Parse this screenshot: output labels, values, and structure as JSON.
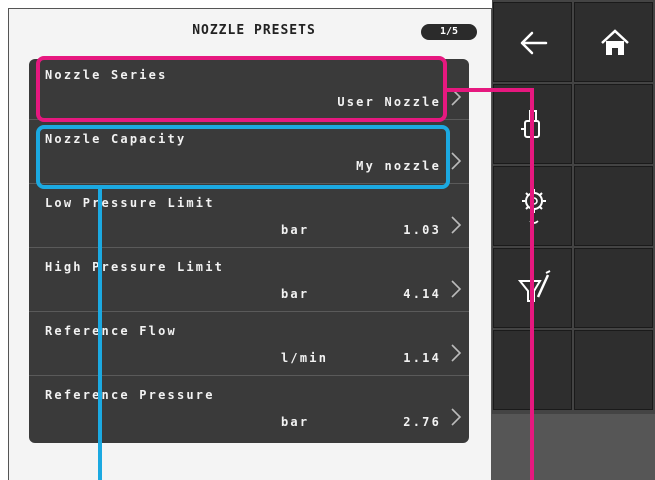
{
  "header": {
    "title": "NOZZLE PRESETS",
    "page_indicator": "1/5"
  },
  "rows": [
    {
      "label": "Nozzle Series",
      "unit": "",
      "value": "User Nozzle"
    },
    {
      "label": "Nozzle Capacity",
      "unit": "",
      "value": "My nozzle"
    },
    {
      "label": "Low Pressure Limit",
      "unit": "bar",
      "value": "1.03"
    },
    {
      "label": "High Pressure Limit",
      "unit": "bar",
      "value": "4.14"
    },
    {
      "label": "Reference Flow",
      "unit": "l/min",
      "value": "1.14"
    },
    {
      "label": "Reference Pressure",
      "unit": "bar",
      "value": "2.76"
    }
  ],
  "sidebar": {
    "buttons": [
      {
        "name": "back-button",
        "icon": "arrow-left-icon"
      },
      {
        "name": "home-button",
        "icon": "home-icon"
      },
      {
        "name": "nozzle-select-button",
        "icon": "nozzle-hand-icon"
      },
      {
        "name": "sidebar-blank-button-1",
        "icon": ""
      },
      {
        "name": "settings-button",
        "icon": "gear-icon"
      },
      {
        "name": "sidebar-blank-button-2",
        "icon": ""
      },
      {
        "name": "calibration-button",
        "icon": "spray-edit-icon"
      },
      {
        "name": "sidebar-blank-button-3",
        "icon": ""
      },
      {
        "name": "sidebar-blank-button-4",
        "icon": ""
      },
      {
        "name": "sidebar-blank-button-5",
        "icon": ""
      }
    ]
  },
  "colors": {
    "callout_magenta": "#e6187f",
    "callout_blue": "#1ba9e1",
    "list_bg": "#3a3a3a",
    "sidebar_bg": "#444444"
  }
}
